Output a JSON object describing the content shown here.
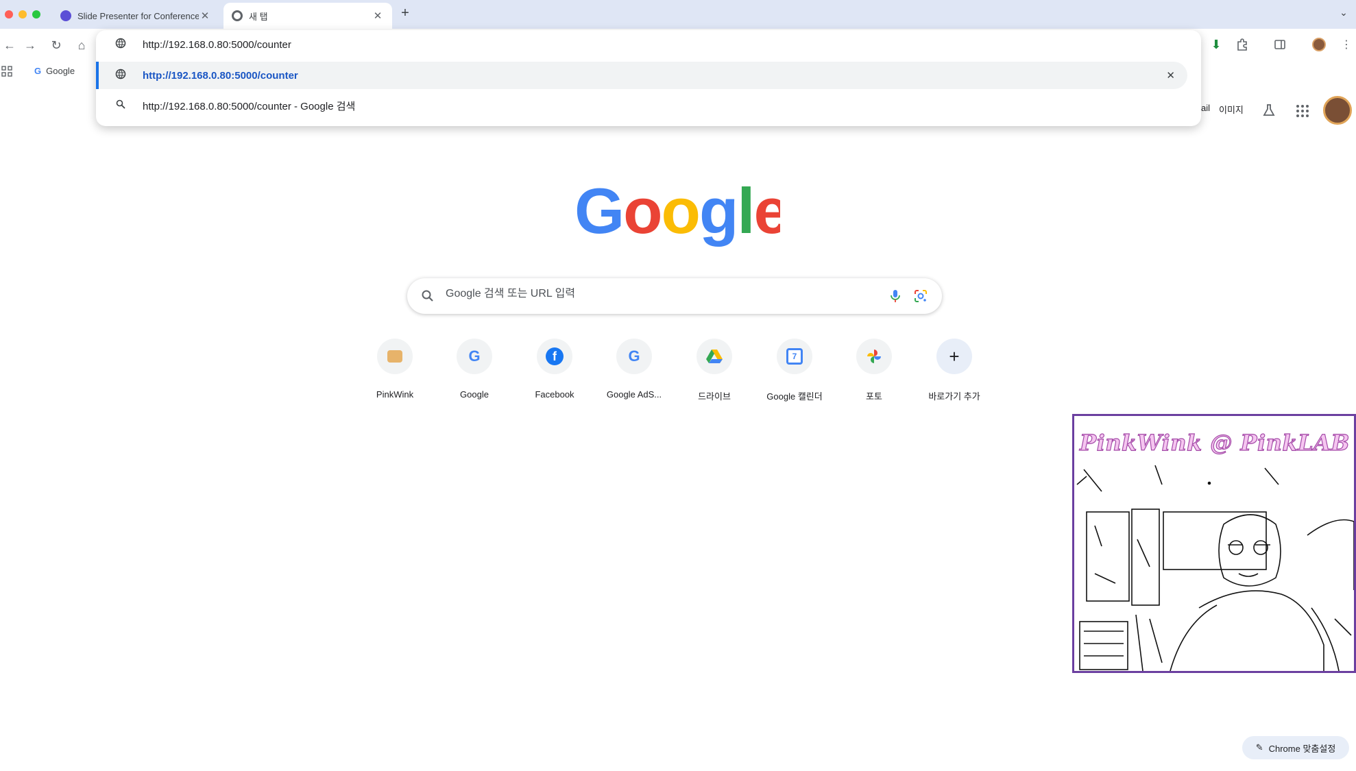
{
  "window": {
    "tabs": [
      {
        "title": "Slide Presenter for Conference",
        "active": false
      },
      {
        "title": "새 탭",
        "active": true
      }
    ]
  },
  "omnibox": {
    "value": "http://192.168.0.80:5000/counter",
    "suggestions": [
      {
        "text": "http://192.168.0.80:5000/counter",
        "kind": "url",
        "selected": true
      },
      {
        "text": "http://192.168.0.80:5000/counter - Google 검색",
        "kind": "search",
        "selected": false
      }
    ]
  },
  "bookmarks": {
    "items": [
      {
        "label": "Google"
      }
    ]
  },
  "google_header": {
    "gmail": "ail",
    "images": "이미지"
  },
  "logo_text": "Google",
  "search": {
    "placeholder": "Google 검색 또는 URL 입력"
  },
  "shortcuts": [
    {
      "label": "PinkWink",
      "icon": "pinkwink-favicon"
    },
    {
      "label": "Google",
      "icon": "google-g-icon"
    },
    {
      "label": "Facebook",
      "icon": "facebook-icon"
    },
    {
      "label": "Google AdS...",
      "icon": "google-g-icon"
    },
    {
      "label": "드라이브",
      "icon": "drive-icon"
    },
    {
      "label": "Google 캘린더",
      "icon": "calendar-icon"
    },
    {
      "label": "포토",
      "icon": "photos-icon"
    },
    {
      "label": "바로가기 추가",
      "icon": "add-icon"
    }
  ],
  "camera_overlay": {
    "caption": "PinkWink @ PinkLAB"
  },
  "customize_button": {
    "label": "Chrome 맞춤설정"
  },
  "colors": {
    "accent": "#1a73e8",
    "tabstrip": "#dfe6f5",
    "overlay_border": "#6b3fa0"
  }
}
